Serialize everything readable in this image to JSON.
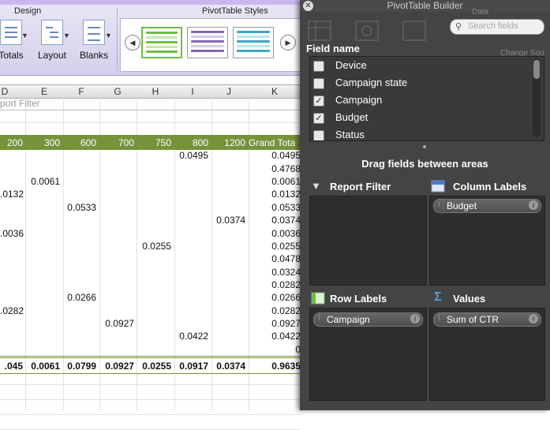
{
  "ribbon": {
    "design_label": "Design",
    "styles_label": "PivotTable Styles",
    "buttons": [
      "Totals",
      "Layout",
      "Blanks"
    ]
  },
  "sheet": {
    "columns": [
      "D",
      "E",
      "F",
      "G",
      "H",
      "I",
      "J",
      "K"
    ],
    "filter_text": "port Filter",
    "header": [
      "200",
      "300",
      "600",
      "700",
      "750",
      "800",
      "1200",
      "Grand Tota"
    ],
    "rows": [
      {
        "vals": [
          "",
          "",
          "",
          "",
          "",
          "0.0495",
          "",
          ""
        ],
        "total": "0.0495"
      },
      {
        "vals": [
          "",
          "",
          "",
          "",
          "",
          "",
          "",
          ""
        ],
        "total": "0.4768"
      },
      {
        "vals": [
          "",
          "0.0061",
          "",
          "",
          "",
          "",
          "",
          ""
        ],
        "total": "0.0061"
      },
      {
        "vals": [
          ".0132",
          "",
          "",
          "",
          "",
          "",
          "",
          ""
        ],
        "total": "0.0132"
      },
      {
        "vals": [
          "",
          "",
          "0.0533",
          "",
          "",
          "",
          "",
          ""
        ],
        "total": "0.0533"
      },
      {
        "vals": [
          "",
          "",
          "",
          "",
          "",
          "",
          "0.0374",
          ""
        ],
        "total": "0.0374"
      },
      {
        "vals": [
          ".0036",
          "",
          "",
          "",
          "",
          "",
          "",
          ""
        ],
        "total": "0.0036"
      },
      {
        "vals": [
          "",
          "",
          "",
          "",
          "0.0255",
          "",
          "",
          ""
        ],
        "total": "0.0255"
      },
      {
        "vals": [
          "",
          "",
          "",
          "",
          "",
          "",
          "",
          ""
        ],
        "total": "0.0478"
      },
      {
        "vals": [
          "",
          "",
          "",
          "",
          "",
          "",
          "",
          ""
        ],
        "total": "0.0324"
      },
      {
        "vals": [
          "",
          "",
          "",
          "",
          "",
          "",
          "",
          ""
        ],
        "total": "0.0282"
      },
      {
        "vals": [
          "",
          "",
          "0.0266",
          "",
          "",
          "",
          "",
          ""
        ],
        "total": "0.0266"
      },
      {
        "vals": [
          ".0282",
          "",
          "",
          "",
          "",
          "",
          "",
          ""
        ],
        "total": "0.0282"
      },
      {
        "vals": [
          "",
          "",
          "",
          "0.0927",
          "",
          "",
          "",
          ""
        ],
        "total": "0.0927"
      },
      {
        "vals": [
          "",
          "",
          "",
          "",
          "",
          "0.0422",
          "",
          ""
        ],
        "total": "0.0422"
      },
      {
        "vals": [
          "",
          "",
          "",
          "",
          "",
          "",
          "",
          ""
        ],
        "total": "0"
      }
    ],
    "totals": [
      ".045",
      "0.0061",
      "0.0799",
      "0.0927",
      "0.0255",
      "0.0917",
      "0.0374",
      "0.9635"
    ]
  },
  "builder": {
    "title": "PivotTable Builder",
    "search_placeholder": "Search fields",
    "faded_data": "Data",
    "faded_change": "Change Sou",
    "field_name_label": "Field name",
    "fields": [
      {
        "name": "Device",
        "checked": false
      },
      {
        "name": "Campaign state",
        "checked": false
      },
      {
        "name": "Campaign",
        "checked": true
      },
      {
        "name": "Budget",
        "checked": true
      },
      {
        "name": "Status",
        "checked": false
      }
    ],
    "drag_hint": "Drag fields between areas",
    "report_filter_label": "Report Filter",
    "column_labels_label": "Column Labels",
    "row_labels_label": "Row Labels",
    "values_label": "Values",
    "column_field": "Budget",
    "row_field": "Campaign",
    "value_field": "Sum of CTR"
  }
}
